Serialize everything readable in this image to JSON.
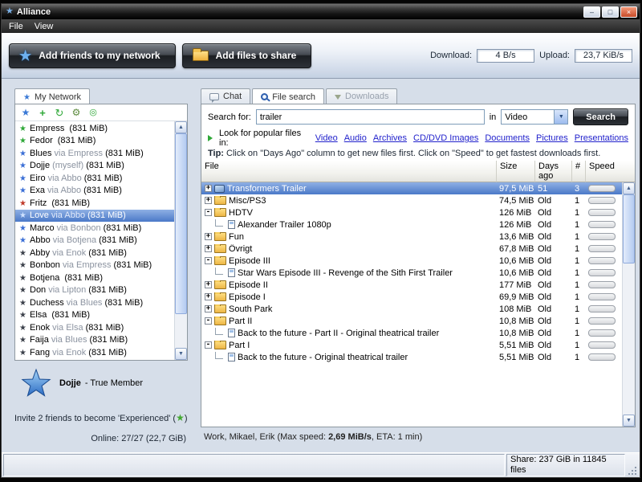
{
  "window": {
    "title": "Alliance",
    "minimize": "–",
    "maximize": "□",
    "close": "×"
  },
  "menu": {
    "items": [
      "File",
      "View"
    ]
  },
  "toolbar": {
    "add_friends_label": "Add friends to my network",
    "add_files_label": "Add files to share",
    "download_label": "Download:",
    "download_value": "4 B/s",
    "upload_label": "Upload:",
    "upload_value": "23,7 KiB/s"
  },
  "network": {
    "tab_label": "My Network",
    "users": [
      {
        "name": "Empress",
        "via": "",
        "size": "(831 MiB)",
        "cls": "st-green"
      },
      {
        "name": "Fedor",
        "via": "",
        "size": "(831 MiB)",
        "cls": "st-green"
      },
      {
        "name": "Blues",
        "via": "via Empress",
        "size": "(831 MiB)",
        "cls": "st-blue"
      },
      {
        "name": "Dojje",
        "via": "(myself)",
        "size": "(831 MiB)",
        "cls": "st-blue"
      },
      {
        "name": "Eiro",
        "via": "via Abbo",
        "size": "(831 MiB)",
        "cls": "st-blue"
      },
      {
        "name": "Exa",
        "via": "via Abbo",
        "size": "(831 MiB)",
        "cls": "st-blue"
      },
      {
        "name": "Fritz",
        "via": "",
        "size": "(831 MiB)",
        "cls": "st-red"
      },
      {
        "name": "Love",
        "via": "via Abbo",
        "size": "(831 MiB)",
        "cls": "st-blue sel"
      },
      {
        "name": "Marco",
        "via": "via Bonbon",
        "size": "(831 MiB)",
        "cls": "st-blue"
      },
      {
        "name": "Abbo",
        "via": "via Botjena",
        "size": "(831 MiB)",
        "cls": "st-blue"
      },
      {
        "name": "Abby",
        "via": "via Enok",
        "size": "(831 MiB)",
        "cls": "st-dark"
      },
      {
        "name": "Bonbon",
        "via": "via Empress",
        "size": "(831 MiB)",
        "cls": "st-dark"
      },
      {
        "name": "Botjena",
        "via": "",
        "size": "(831 MiB)",
        "cls": "st-dark"
      },
      {
        "name": "Don",
        "via": "via Lipton",
        "size": "(831 MiB)",
        "cls": "st-dark"
      },
      {
        "name": "Duchess",
        "via": "via Blues",
        "size": "(831 MiB)",
        "cls": "st-dark"
      },
      {
        "name": "Elsa",
        "via": "",
        "size": "(831 MiB)",
        "cls": "st-dark"
      },
      {
        "name": "Enok",
        "via": "via Elsa",
        "size": "(831 MiB)",
        "cls": "st-dark"
      },
      {
        "name": "Faija",
        "via": "via Blues",
        "size": "(831 MiB)",
        "cls": "st-dark"
      },
      {
        "name": "Fang",
        "via": "via Enok",
        "size": "(831 MiB)",
        "cls": "st-dark"
      }
    ],
    "member_name": "Dojje",
    "member_title": "- True Member",
    "invite_before": "Invite 2 friends to become 'Experienced' (",
    "invite_after": ")",
    "online": "Online: 27/27 (22,7 GiB)"
  },
  "search": {
    "tabs": {
      "chat": "Chat",
      "file_search": "File search",
      "downloads": "Downloads"
    },
    "search_label": "Search for:",
    "query": "trailer",
    "in_label": "in",
    "category": "Video",
    "button_label": "Search",
    "popular_label": "Look for popular files in:",
    "links": [
      "Video",
      "Audio",
      "Archives",
      "CD/DVD Images",
      "Documents",
      "Pictures",
      "Presentations"
    ],
    "tip_label": "Tip:",
    "tip_text": "Click on \"Days Ago\" column to get new files first. Click on \"Speed\" to get fastest downloads first.",
    "columns": [
      "File",
      "Size",
      "Days ago",
      "#",
      "Speed"
    ],
    "results": [
      {
        "name": "Transformers Trailer",
        "size": "97,5 MiB",
        "age": "51",
        "count": "3",
        "expand": "+",
        "cls": "sel icon-screen"
      },
      {
        "name": "Misc/PS3",
        "size": "74,5 MiB",
        "age": "Old",
        "count": "1",
        "expand": "+",
        "cls": "icon-folder"
      },
      {
        "name": "HDTV",
        "size": "126 MiB",
        "age": "Old",
        "count": "1",
        "expand": "-",
        "cls": "icon-folder"
      },
      {
        "name": "Alexander Trailer 1080p",
        "size": "126 MiB",
        "age": "Old",
        "count": "1",
        "expand": "",
        "cls": "lvl1 icon-file"
      },
      {
        "name": "Fun",
        "size": "13,6 MiB",
        "age": "Old",
        "count": "1",
        "expand": "+",
        "cls": "icon-folder"
      },
      {
        "name": "Övrigt",
        "size": "67,8 MiB",
        "age": "Old",
        "count": "1",
        "expand": "+",
        "cls": "icon-folder"
      },
      {
        "name": "Episode III",
        "size": "10,6 MiB",
        "age": "Old",
        "count": "1",
        "expand": "-",
        "cls": "icon-folder"
      },
      {
        "name": "Star Wars Episode III - Revenge of the Sith First Trailer",
        "size": "10,6 MiB",
        "age": "Old",
        "count": "1",
        "expand": "",
        "cls": "lvl1 icon-file"
      },
      {
        "name": "Episode II",
        "size": "177 MiB",
        "age": "Old",
        "count": "1",
        "expand": "+",
        "cls": "icon-folder"
      },
      {
        "name": "Episode I",
        "size": "69,9 MiB",
        "age": "Old",
        "count": "1",
        "expand": "+",
        "cls": "icon-folder"
      },
      {
        "name": "South Park",
        "size": "108 MiB",
        "age": "Old",
        "count": "1",
        "expand": "+",
        "cls": "icon-folder"
      },
      {
        "name": "Part II",
        "size": "10,8 MiB",
        "age": "Old",
        "count": "1",
        "expand": "-",
        "cls": "icon-folder"
      },
      {
        "name": "Back to the future - Part II - Original theatrical trailer",
        "size": "10,8 MiB",
        "age": "Old",
        "count": "1",
        "expand": "",
        "cls": "lvl1 icon-file"
      },
      {
        "name": "Part I",
        "size": "5,51 MiB",
        "age": "Old",
        "count": "1",
        "expand": "-",
        "cls": "icon-folder"
      },
      {
        "name": "Back to the future - Original theatrical trailer",
        "size": "5,51 MiB",
        "age": "Old",
        "count": "1",
        "expand": "",
        "cls": "lvl1 icon-file"
      }
    ],
    "status_prefix": "Work, Mikael, Erik (Max speed: ",
    "status_speed": "2,69 MiB/s",
    "status_suffix": ", ETA: 1 min)"
  },
  "statusbar": {
    "share": "Share: 237 GiB in 11845 files"
  },
  "colors": {
    "selection_top": "#8fb0e4",
    "selection_bottom": "#4b79c8",
    "link": "#2222cc",
    "user_online": "#2fa838",
    "user_connected": "#3b6fd6",
    "user_offline": "#3c414b",
    "user_warning": "#c03a2a"
  },
  "icons": {
    "star": "★",
    "up_arrow": "▲",
    "down_arrow": "▼",
    "refresh": "↻",
    "gear": "⚙"
  }
}
